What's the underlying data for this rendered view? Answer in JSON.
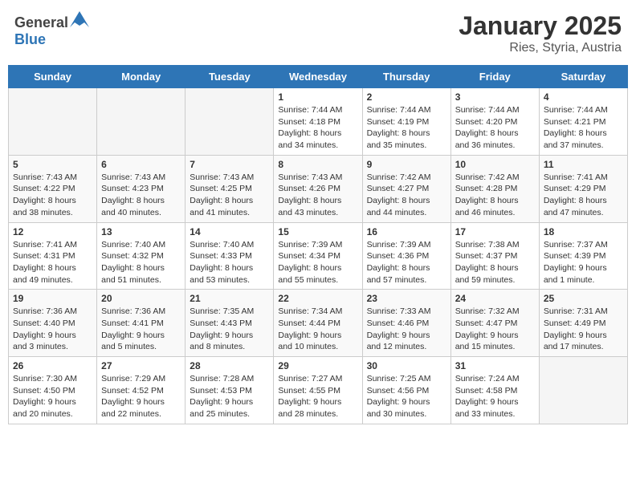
{
  "header": {
    "logo_general": "General",
    "logo_blue": "Blue",
    "title": "January 2025",
    "subtitle": "Ries, Styria, Austria"
  },
  "days_of_week": [
    "Sunday",
    "Monday",
    "Tuesday",
    "Wednesday",
    "Thursday",
    "Friday",
    "Saturday"
  ],
  "weeks": [
    [
      {
        "day": "",
        "info": ""
      },
      {
        "day": "",
        "info": ""
      },
      {
        "day": "",
        "info": ""
      },
      {
        "day": "1",
        "info": "Sunrise: 7:44 AM\nSunset: 4:18 PM\nDaylight: 8 hours\nand 34 minutes."
      },
      {
        "day": "2",
        "info": "Sunrise: 7:44 AM\nSunset: 4:19 PM\nDaylight: 8 hours\nand 35 minutes."
      },
      {
        "day": "3",
        "info": "Sunrise: 7:44 AM\nSunset: 4:20 PM\nDaylight: 8 hours\nand 36 minutes."
      },
      {
        "day": "4",
        "info": "Sunrise: 7:44 AM\nSunset: 4:21 PM\nDaylight: 8 hours\nand 37 minutes."
      }
    ],
    [
      {
        "day": "5",
        "info": "Sunrise: 7:43 AM\nSunset: 4:22 PM\nDaylight: 8 hours\nand 38 minutes."
      },
      {
        "day": "6",
        "info": "Sunrise: 7:43 AM\nSunset: 4:23 PM\nDaylight: 8 hours\nand 40 minutes."
      },
      {
        "day": "7",
        "info": "Sunrise: 7:43 AM\nSunset: 4:25 PM\nDaylight: 8 hours\nand 41 minutes."
      },
      {
        "day": "8",
        "info": "Sunrise: 7:43 AM\nSunset: 4:26 PM\nDaylight: 8 hours\nand 43 minutes."
      },
      {
        "day": "9",
        "info": "Sunrise: 7:42 AM\nSunset: 4:27 PM\nDaylight: 8 hours\nand 44 minutes."
      },
      {
        "day": "10",
        "info": "Sunrise: 7:42 AM\nSunset: 4:28 PM\nDaylight: 8 hours\nand 46 minutes."
      },
      {
        "day": "11",
        "info": "Sunrise: 7:41 AM\nSunset: 4:29 PM\nDaylight: 8 hours\nand 47 minutes."
      }
    ],
    [
      {
        "day": "12",
        "info": "Sunrise: 7:41 AM\nSunset: 4:31 PM\nDaylight: 8 hours\nand 49 minutes."
      },
      {
        "day": "13",
        "info": "Sunrise: 7:40 AM\nSunset: 4:32 PM\nDaylight: 8 hours\nand 51 minutes."
      },
      {
        "day": "14",
        "info": "Sunrise: 7:40 AM\nSunset: 4:33 PM\nDaylight: 8 hours\nand 53 minutes."
      },
      {
        "day": "15",
        "info": "Sunrise: 7:39 AM\nSunset: 4:34 PM\nDaylight: 8 hours\nand 55 minutes."
      },
      {
        "day": "16",
        "info": "Sunrise: 7:39 AM\nSunset: 4:36 PM\nDaylight: 8 hours\nand 57 minutes."
      },
      {
        "day": "17",
        "info": "Sunrise: 7:38 AM\nSunset: 4:37 PM\nDaylight: 8 hours\nand 59 minutes."
      },
      {
        "day": "18",
        "info": "Sunrise: 7:37 AM\nSunset: 4:39 PM\nDaylight: 9 hours\nand 1 minute."
      }
    ],
    [
      {
        "day": "19",
        "info": "Sunrise: 7:36 AM\nSunset: 4:40 PM\nDaylight: 9 hours\nand 3 minutes."
      },
      {
        "day": "20",
        "info": "Sunrise: 7:36 AM\nSunset: 4:41 PM\nDaylight: 9 hours\nand 5 minutes."
      },
      {
        "day": "21",
        "info": "Sunrise: 7:35 AM\nSunset: 4:43 PM\nDaylight: 9 hours\nand 8 minutes."
      },
      {
        "day": "22",
        "info": "Sunrise: 7:34 AM\nSunset: 4:44 PM\nDaylight: 9 hours\nand 10 minutes."
      },
      {
        "day": "23",
        "info": "Sunrise: 7:33 AM\nSunset: 4:46 PM\nDaylight: 9 hours\nand 12 minutes."
      },
      {
        "day": "24",
        "info": "Sunrise: 7:32 AM\nSunset: 4:47 PM\nDaylight: 9 hours\nand 15 minutes."
      },
      {
        "day": "25",
        "info": "Sunrise: 7:31 AM\nSunset: 4:49 PM\nDaylight: 9 hours\nand 17 minutes."
      }
    ],
    [
      {
        "day": "26",
        "info": "Sunrise: 7:30 AM\nSunset: 4:50 PM\nDaylight: 9 hours\nand 20 minutes."
      },
      {
        "day": "27",
        "info": "Sunrise: 7:29 AM\nSunset: 4:52 PM\nDaylight: 9 hours\nand 22 minutes."
      },
      {
        "day": "28",
        "info": "Sunrise: 7:28 AM\nSunset: 4:53 PM\nDaylight: 9 hours\nand 25 minutes."
      },
      {
        "day": "29",
        "info": "Sunrise: 7:27 AM\nSunset: 4:55 PM\nDaylight: 9 hours\nand 28 minutes."
      },
      {
        "day": "30",
        "info": "Sunrise: 7:25 AM\nSunset: 4:56 PM\nDaylight: 9 hours\nand 30 minutes."
      },
      {
        "day": "31",
        "info": "Sunrise: 7:24 AM\nSunset: 4:58 PM\nDaylight: 9 hours\nand 33 minutes."
      },
      {
        "day": "",
        "info": ""
      }
    ]
  ]
}
